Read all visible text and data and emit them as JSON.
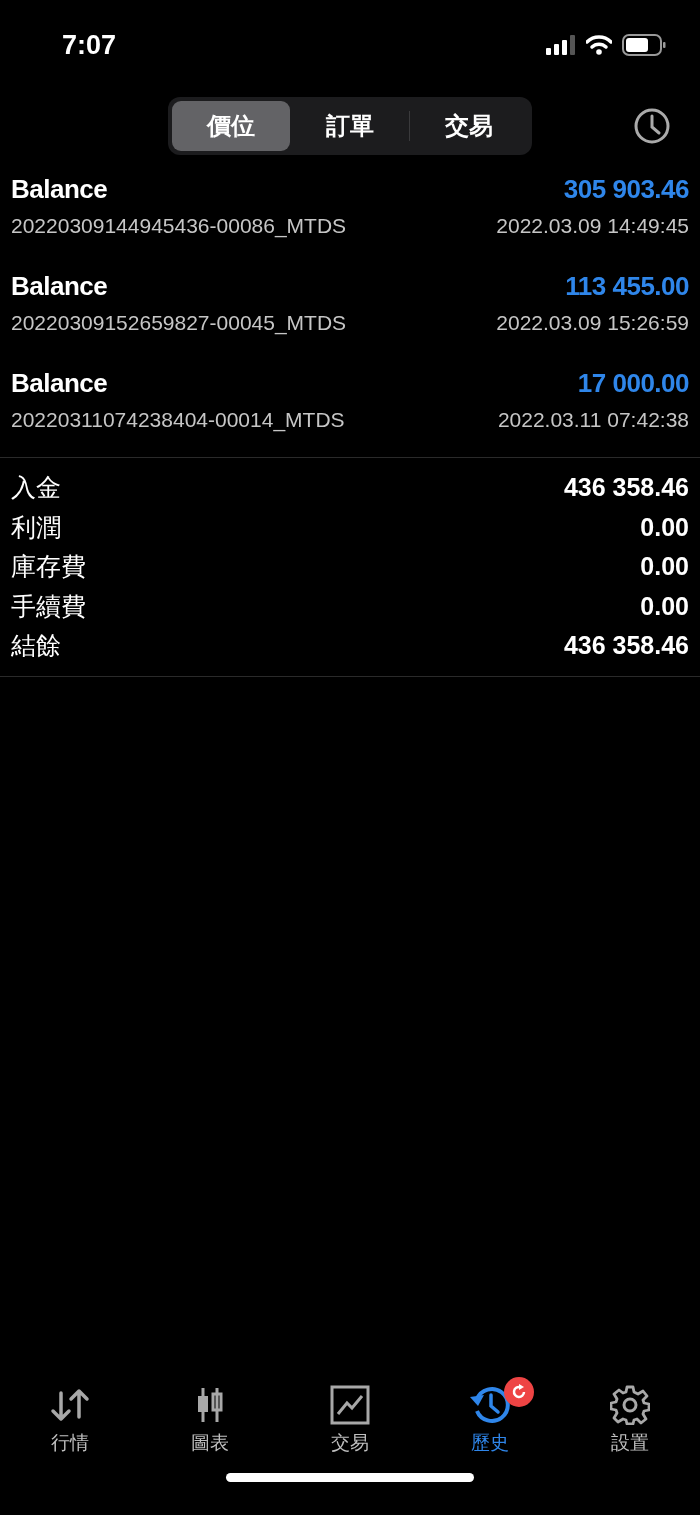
{
  "status_bar": {
    "time": "7:07"
  },
  "segments": [
    {
      "label": "價位",
      "selected": true
    },
    {
      "label": "訂單",
      "selected": false
    },
    {
      "label": "交易",
      "selected": false
    }
  ],
  "deals": [
    {
      "title": "Balance",
      "amount": "305 903.46",
      "ticket": "20220309144945436-00086_MTDS",
      "time": "2022.03.09 14:49:45"
    },
    {
      "title": "Balance",
      "amount": "113 455.00",
      "ticket": "20220309152659827-00045_MTDS",
      "time": "2022.03.09 15:26:59"
    },
    {
      "title": "Balance",
      "amount": "17 000.00",
      "ticket": "20220311074238404-00014_MTDS",
      "time": "2022.03.11 07:42:38"
    }
  ],
  "summary": [
    {
      "label": "入金",
      "value": "436 358.46"
    },
    {
      "label": "利潤",
      "value": "0.00"
    },
    {
      "label": "庫存費",
      "value": "0.00"
    },
    {
      "label": "手續費",
      "value": "0.00"
    },
    {
      "label": "結餘",
      "value": "436 358.46"
    }
  ],
  "tab_bar": [
    {
      "kind": "quotes",
      "label": "行情",
      "selected": false
    },
    {
      "kind": "chart",
      "label": "圖表",
      "selected": false
    },
    {
      "kind": "trade",
      "label": "交易",
      "selected": false
    },
    {
      "kind": "history",
      "label": "歷史",
      "selected": true,
      "badge": true
    },
    {
      "kind": "settings",
      "label": "設置",
      "selected": false
    }
  ]
}
